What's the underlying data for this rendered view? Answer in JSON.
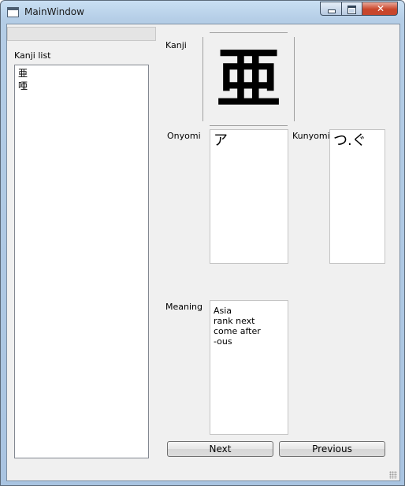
{
  "window": {
    "title": "MainWindow",
    "close_glyph": "✕"
  },
  "search": {
    "value": ""
  },
  "kanji_list": {
    "label": "Kanji list",
    "items": [
      "亜",
      "唖"
    ]
  },
  "detail": {
    "kanji_label": "Kanji",
    "kanji_value": "亜",
    "onyomi_label": "Onyomi",
    "onyomi_value": "ア",
    "kunyomi_label": "Kunyomi",
    "kunyomi_value": "つ.ぐ",
    "meaning_label": "Meaning",
    "meaning_value": "Asia\nrank next\ncome after\n-ous"
  },
  "buttons": {
    "next": "Next",
    "previous": "Previous"
  },
  "icons": {
    "app": "window-icon",
    "minimize": "minimize-icon",
    "maximize": "maximize-icon",
    "close": "close-icon",
    "size_grip": "size-grip-icon"
  }
}
